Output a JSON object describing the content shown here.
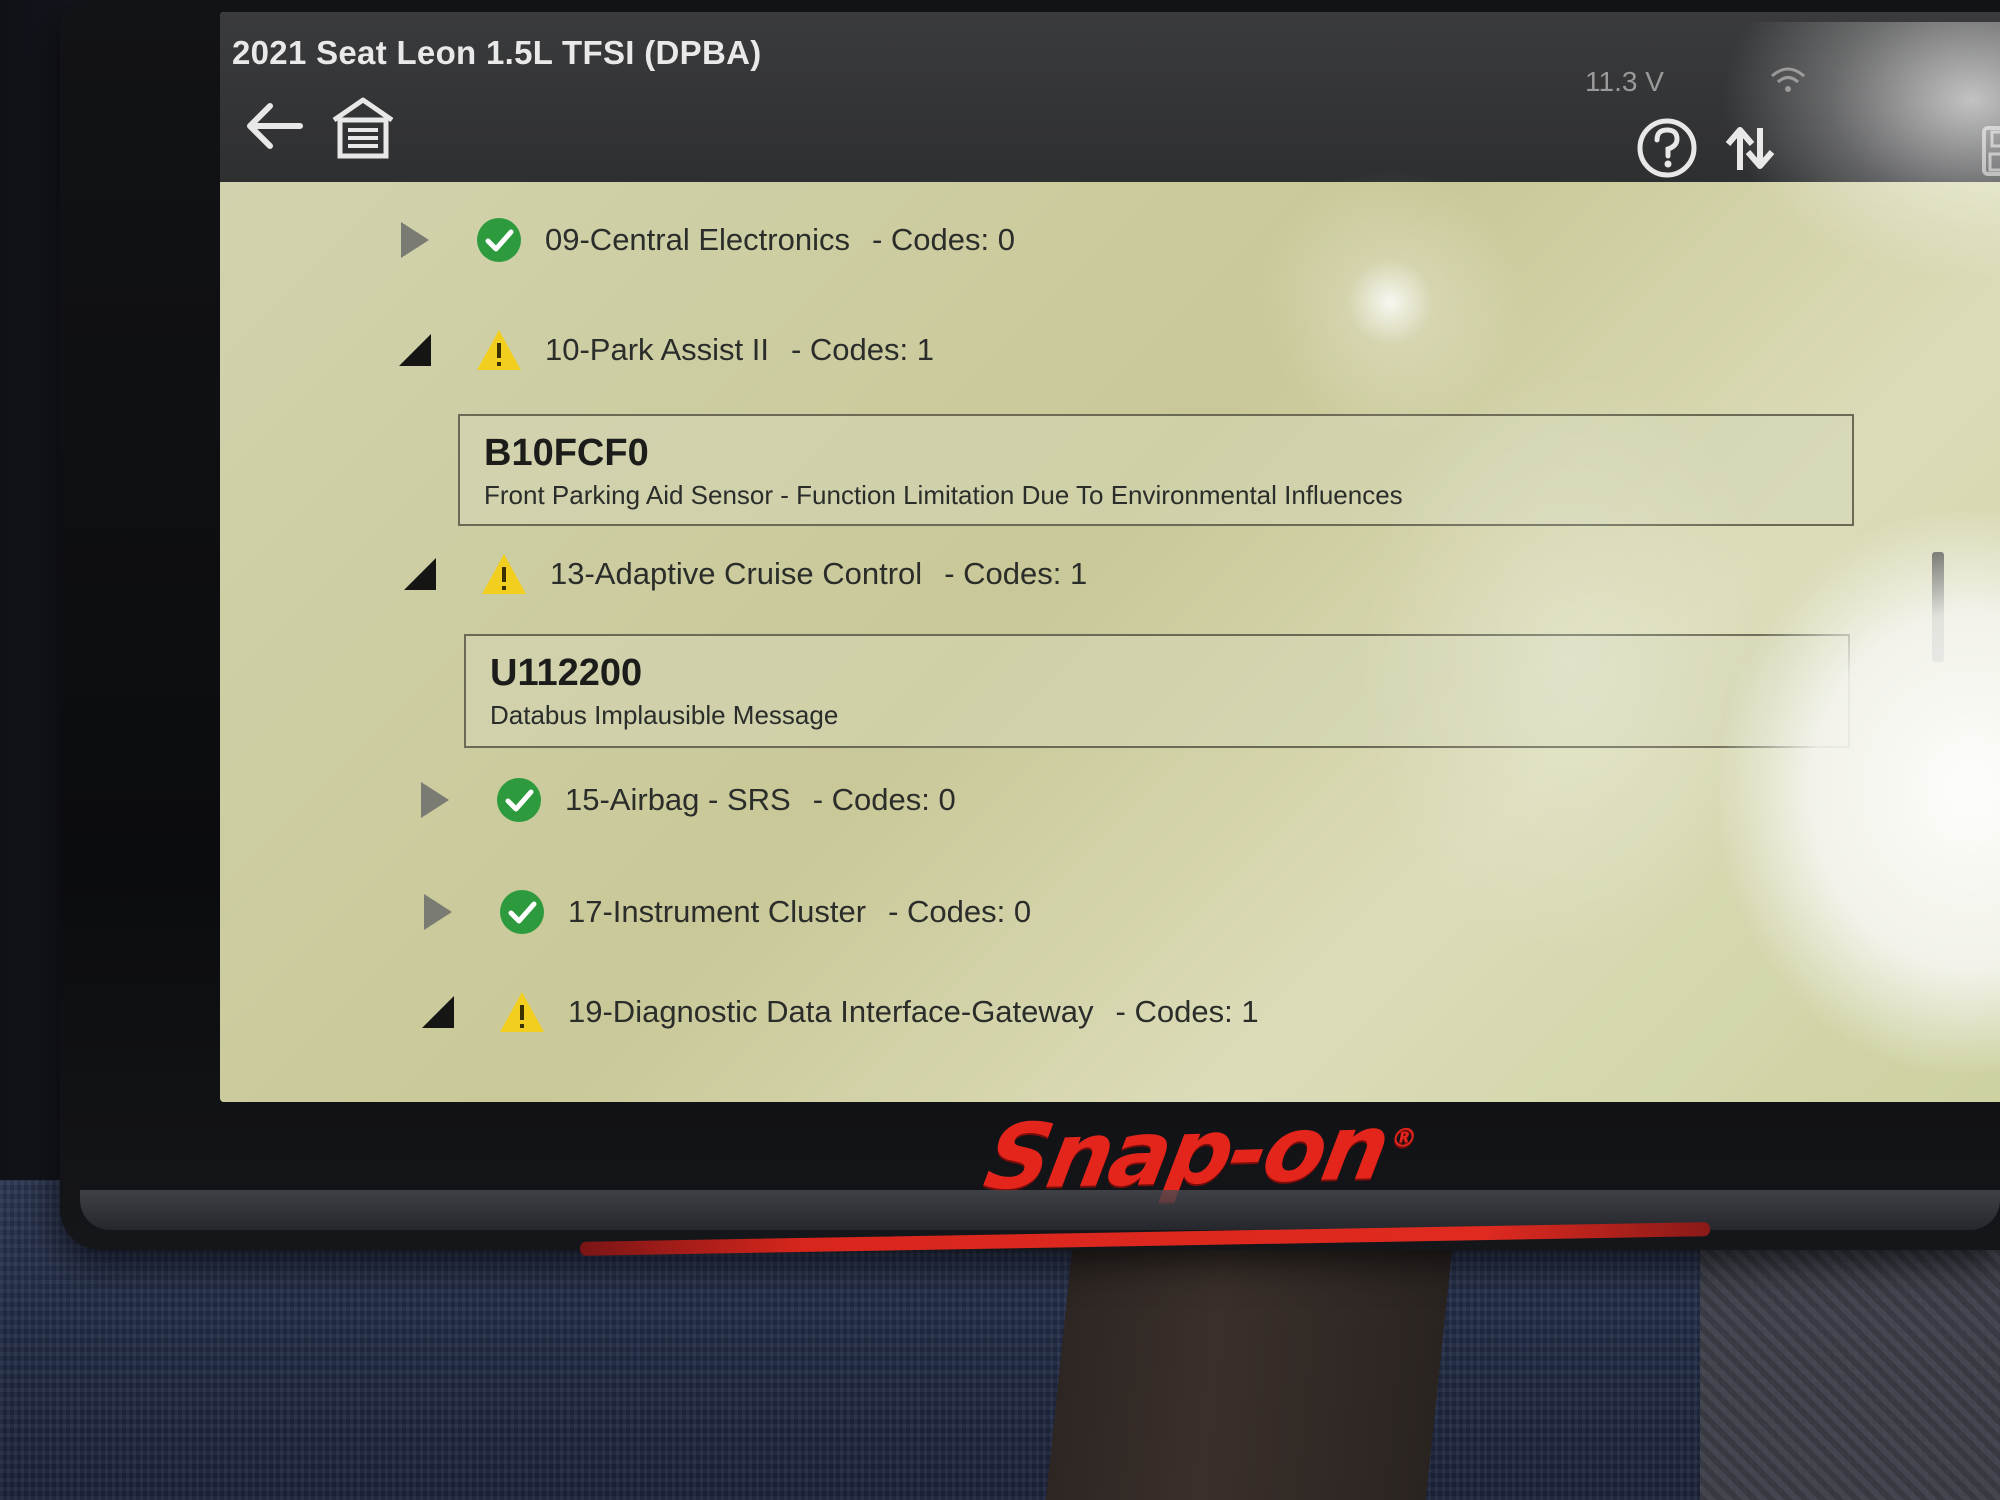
{
  "header": {
    "vehicle_title": "2021 Seat Leon 1.5L TFSI (DPBA)",
    "voltage": "11.3 V"
  },
  "toolbar": {
    "back_icon": "back-arrow-icon",
    "home_icon": "garage-home-icon",
    "help_icon": "help-icon",
    "share_icon": "share-icon",
    "save_icon": "save-icon"
  },
  "modules": [
    {
      "name": "09-Central Electronics",
      "codes": "- Codes: 0",
      "status": "ok",
      "expanded": false
    },
    {
      "name": "10-Park Assist II",
      "codes": "- Codes: 1",
      "status": "warning",
      "expanded": true,
      "dtc": {
        "code": "B10FCF0",
        "description": "Front Parking Aid Sensor - Function Limitation Due To Environmental Influences"
      }
    },
    {
      "name": "13-Adaptive Cruise Control",
      "codes": "- Codes: 1",
      "status": "warning",
      "expanded": true,
      "dtc": {
        "code": "U112200",
        "description": "Databus Implausible Message"
      }
    },
    {
      "name": "15-Airbag - SRS",
      "codes": "- Codes: 0",
      "status": "ok",
      "expanded": false
    },
    {
      "name": "17-Instrument Cluster",
      "codes": "- Codes: 0",
      "status": "ok",
      "expanded": false
    },
    {
      "name": "19-Diagnostic Data Interface-Gateway",
      "codes": "- Codes: 1",
      "status": "warning",
      "expanded": true
    }
  ],
  "device": {
    "brand": "Snap-on",
    "brand_color": "#e3251c"
  },
  "colors": {
    "ok_green": "#2e9a3e",
    "warning_yellow": "#f2cf1f",
    "screen_bg": "#c9c99a",
    "header_bg": "#323335"
  }
}
